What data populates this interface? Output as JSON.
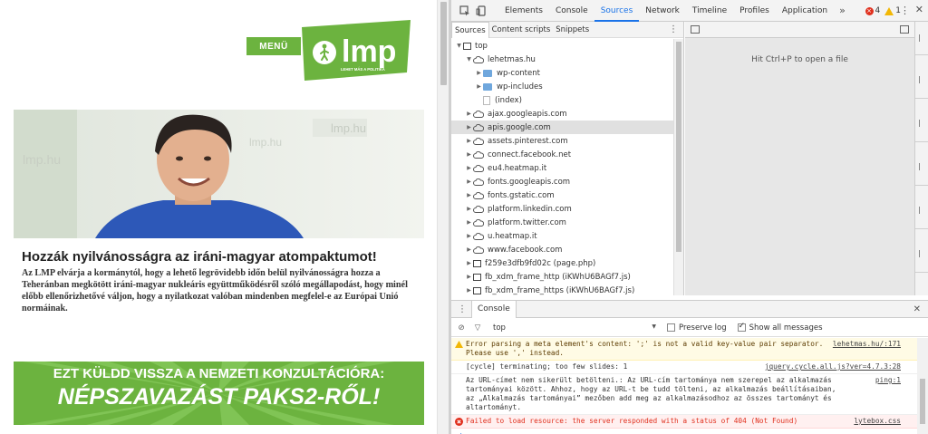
{
  "site": {
    "menu_label": "MENÜ",
    "logo_text": "lmp",
    "logo_tagline": "LEHET MÁS A POLITIKA",
    "hero_caption": "Hozzák nyilvánosságra az iráni-magyar atompaktumot!",
    "hero_text": "Az LMP elvárja a kormánytól, hogy a lehető legrövidebb időn belül nyilvánosságra hozza a Teheránban megkötött iráni-magyar nukleáris együttműködésről szóló megállapodást, hogy minél előbb ellenőrizhetővé váljon, hogy a nyilatkozat valóban mindenben megfelel-e az Európai Unió normáinak.",
    "banner_line1": "EZT KÜLDD VISSZA A NEMZETI KONZULTÁCIÓRA:",
    "banner_line2": "NÉPSZAVAZÁST PAKS2-RŐL!",
    "brand_green": "#6cb33f"
  },
  "devtools": {
    "tabs": [
      "Elements",
      "Console",
      "Sources",
      "Network",
      "Timeline",
      "Profiles",
      "Application"
    ],
    "active_tab": "Sources",
    "more_tabs": "»",
    "error_count": "4",
    "warning_count": "1",
    "navigator_tabs": [
      "Sources",
      "Content scripts",
      "Snippets"
    ],
    "tree": [
      {
        "label": "top",
        "type": "frame",
        "indent": 0,
        "arrow": "▼"
      },
      {
        "label": "lehetmas.hu",
        "type": "cloud",
        "indent": 1,
        "arrow": "▼"
      },
      {
        "label": "wp-content",
        "type": "folder",
        "indent": 2,
        "arrow": "▶"
      },
      {
        "label": "wp-includes",
        "type": "folder",
        "indent": 2,
        "arrow": "▶"
      },
      {
        "label": "(index)",
        "type": "file",
        "indent": 2,
        "arrow": ""
      },
      {
        "label": "ajax.googleapis.com",
        "type": "cloud",
        "indent": 1,
        "arrow": "▶"
      },
      {
        "label": "apis.google.com",
        "type": "cloud",
        "indent": 1,
        "arrow": "▶",
        "selected": true
      },
      {
        "label": "assets.pinterest.com",
        "type": "cloud",
        "indent": 1,
        "arrow": "▶"
      },
      {
        "label": "connect.facebook.net",
        "type": "cloud",
        "indent": 1,
        "arrow": "▶"
      },
      {
        "label": "eu4.heatmap.it",
        "type": "cloud",
        "indent": 1,
        "arrow": "▶"
      },
      {
        "label": "fonts.googleapis.com",
        "type": "cloud",
        "indent": 1,
        "arrow": "▶"
      },
      {
        "label": "fonts.gstatic.com",
        "type": "cloud",
        "indent": 1,
        "arrow": "▶"
      },
      {
        "label": "platform.linkedin.com",
        "type": "cloud",
        "indent": 1,
        "arrow": "▶"
      },
      {
        "label": "platform.twitter.com",
        "type": "cloud",
        "indent": 1,
        "arrow": "▶"
      },
      {
        "label": "u.heatmap.it",
        "type": "cloud",
        "indent": 1,
        "arrow": "▶"
      },
      {
        "label": "www.facebook.com",
        "type": "cloud",
        "indent": 1,
        "arrow": "▶"
      },
      {
        "label": "f259e3dfb9fd02c (page.php)",
        "type": "frame",
        "indent": 1,
        "arrow": "▶"
      },
      {
        "label": "fb_xdm_frame_http (iKWhU6BAGf7.js)",
        "type": "frame",
        "indent": 1,
        "arrow": "▶"
      },
      {
        "label": "fb_xdm_frame_https (iKWhU6BAGf7.js)",
        "type": "frame",
        "indent": 1,
        "arrow": "▶"
      }
    ],
    "editor_hint": "Hit Ctrl+P to open a file",
    "drawer_tab": "Console",
    "console_context": "top",
    "preserve_log_label": "Preserve log",
    "show_all_label": "Show all messages",
    "messages": [
      {
        "level": "warn",
        "text": "Error parsing a meta element's content: ';' is not a valid key-value pair separator. Please use ',' instead.",
        "source": "lehetmas.hu/:171"
      },
      {
        "level": "log",
        "text": "[cycle] terminating; too few slides: 1",
        "source": "jquery.cycle.all.js?ver=4.7.3:28"
      },
      {
        "level": "log",
        "text": "Az URL-címet nem sikerült betölteni.: Az URL-cím tartománya nem szerepel az alkalmazás tartományai között. Ahhoz, hogy az URL-t be tudd tölteni, az alkalmazás beállításaiban, az „Alkalmazás tartományai” mezőben add meg az alkalmazásodhoz az összes tartományt és altartományt.",
        "source": "ping:1"
      },
      {
        "level": "error",
        "text": "Failed to load resource: the server responded with a status of 404 (Not Found)",
        "source": "lytebox.css"
      }
    ],
    "prompt_symbol": "›",
    "accent": "#1a73e8",
    "error_color": "#e0301e",
    "warning_color": "#f2b705"
  }
}
